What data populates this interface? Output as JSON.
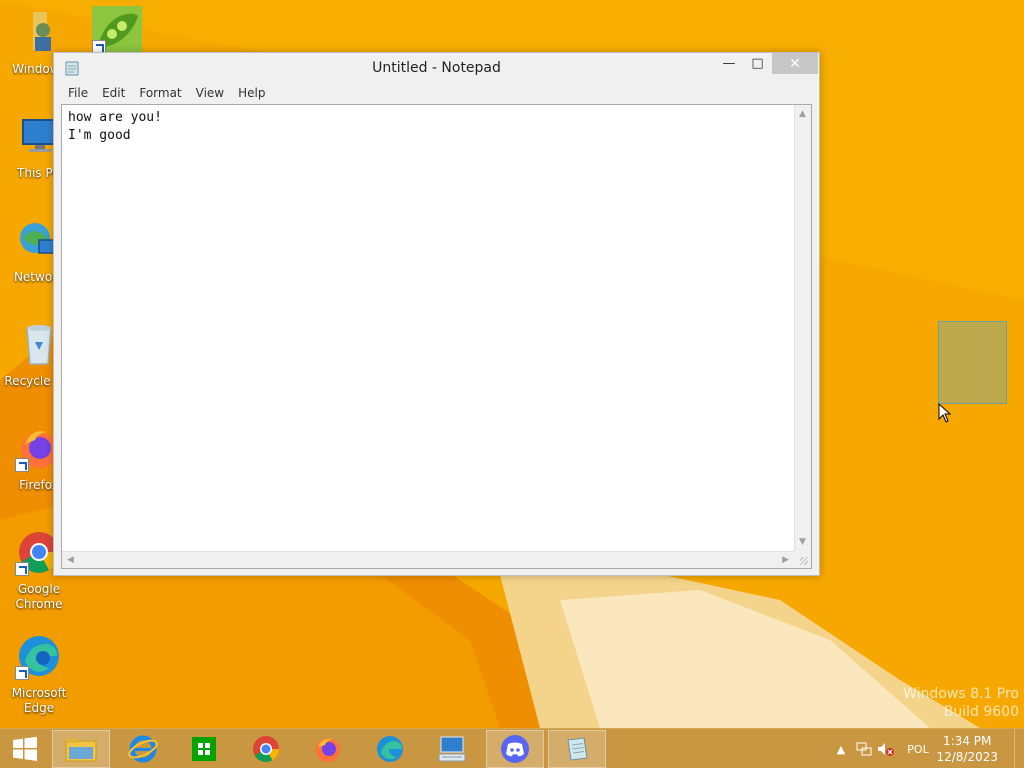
{
  "desktop": {
    "icons": [
      {
        "label": "Windows"
      },
      {
        "label": ""
      },
      {
        "label": "This PC"
      },
      {
        "label": "Network"
      },
      {
        "label": "Recycle Bin"
      },
      {
        "label": "Firefox"
      },
      {
        "label": "Google Chrome"
      },
      {
        "label": "Microsoft Edge"
      }
    ],
    "watermark": {
      "line1": "Windows 8.1 Pro",
      "line2": "Build 9600"
    }
  },
  "notepad": {
    "title": "Untitled - Notepad",
    "menu": [
      "File",
      "Edit",
      "Format",
      "View",
      "Help"
    ],
    "content": "how are you!\nI'm good",
    "controls": {
      "minimize": "—",
      "maximize": "□",
      "close": "✕"
    }
  },
  "taskbar": {
    "items": [
      {
        "name": "file-explorer"
      },
      {
        "name": "internet-explorer"
      },
      {
        "name": "store"
      },
      {
        "name": "google-chrome"
      },
      {
        "name": "firefox"
      },
      {
        "name": "microsoft-edge"
      },
      {
        "name": "remote-desktop"
      },
      {
        "name": "discord"
      },
      {
        "name": "notepad"
      }
    ],
    "tray": {
      "language": "POL",
      "time": "1:34 PM",
      "date": "12/8/2023"
    }
  },
  "colors": {
    "wallpaper": "#f7a800",
    "taskbar": "#c49646"
  }
}
